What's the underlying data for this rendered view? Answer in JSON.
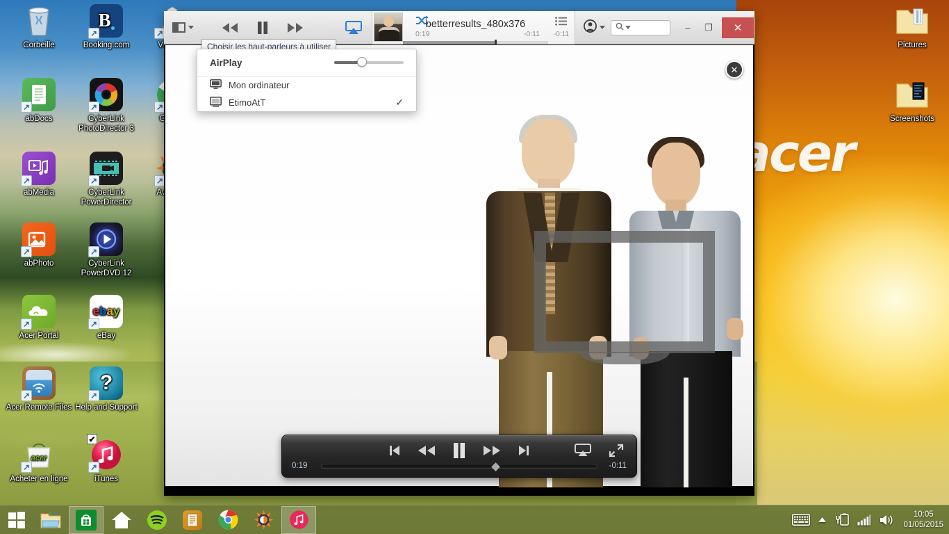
{
  "desktop": {
    "icons": [
      {
        "label": "Corbeille",
        "name": "recycle-bin",
        "kind": "bin",
        "shortcut": false
      },
      {
        "label": "Booking.com",
        "name": "booking-com",
        "kind": "booking",
        "shortcut": true
      },
      {
        "label": "VLC me",
        "name": "vlc-media-player",
        "kind": "vlc",
        "shortcut": true
      },
      {
        "label": "abDocs",
        "name": "abdocs",
        "kind": "abdocs",
        "shortcut": true
      },
      {
        "label": "CyberLink PhotoDirector 3",
        "name": "cyberlink-photodirector",
        "kind": "photodirector",
        "shortcut": true
      },
      {
        "label": "Google",
        "name": "google-chrome",
        "kind": "chrome",
        "shortcut": true
      },
      {
        "label": "abMedia",
        "name": "abmedia",
        "kind": "abmedia",
        "shortcut": true
      },
      {
        "label": "CyberLink PowerDirector",
        "name": "cyberlink-powerdirector",
        "kind": "powerdirector",
        "shortcut": true
      },
      {
        "label": "Avas Ant",
        "name": "avast-antivirus",
        "kind": "avast",
        "shortcut": true
      },
      {
        "label": "abPhoto",
        "name": "abphoto",
        "kind": "abphoto",
        "shortcut": true
      },
      {
        "label": "CyberLink PowerDVD 12",
        "name": "cyberlink-powerdvd",
        "kind": "powerdvd",
        "shortcut": true
      },
      {
        "label": "Acer Portal",
        "name": "acer-portal",
        "kind": "acerportal",
        "shortcut": true
      },
      {
        "label": "eBay",
        "name": "ebay",
        "kind": "ebay",
        "shortcut": true
      },
      {
        "label": "Acer Remote Files",
        "name": "acer-remote-files",
        "kind": "remotefiles",
        "shortcut": true
      },
      {
        "label": "Help and Support",
        "name": "help-and-support",
        "kind": "help",
        "shortcut": true
      },
      {
        "label": "Acheter en ligne",
        "name": "acheter-en-ligne",
        "kind": "acerbag",
        "shortcut": true
      },
      {
        "label": "iTunes",
        "name": "itunes",
        "kind": "itunes",
        "shortcut": true,
        "checked": true
      },
      {
        "label": "Pictures",
        "name": "pictures-folder",
        "kind": "folder",
        "shortcut": false
      },
      {
        "label": "Screenshots",
        "name": "screenshots-folder",
        "kind": "folderdark",
        "shortcut": false
      }
    ],
    "wallpaper_word": "acer"
  },
  "itunes": {
    "toolbar": {
      "view_toggle_icon": "sidebar-toggle-icon",
      "rewind_icon": "rewind-icon",
      "pause_icon": "pause-icon",
      "forward_icon": "fast-forward-icon",
      "airplay_icon": "airplay-icon",
      "tooltip": "Choisir les haut-parleurs à utiliser"
    },
    "lcd": {
      "shuffle_icon": "shuffle-icon",
      "elapsed": "0:19",
      "title": "betterresults_480x376",
      "remaining": "-0:11",
      "list_icon": "list-icon",
      "progress_percent": 63
    },
    "window": {
      "account_icon": "account-icon",
      "account_caret": "chevron-down-icon",
      "search_icon": "search-icon",
      "search_caret": "chevron-down-icon",
      "search_placeholder": "",
      "search_value": "",
      "minimize": "–",
      "maximize": "❐",
      "close": "✕"
    },
    "airplay_popover": {
      "title": "AirPlay",
      "volume_percent": 40,
      "devices": [
        {
          "label": "Mon ordinateur",
          "icon": "computer-icon",
          "selected": false
        },
        {
          "label": "EtimoAtT",
          "icon": "display-icon",
          "selected": true
        }
      ],
      "check_glyph": "✓"
    },
    "video": {
      "close_glyph": "✕",
      "hud": {
        "prev_icon": "skip-previous-icon",
        "rewind_icon": "rewind-icon",
        "pause_icon": "pause-icon",
        "forward_icon": "fast-forward-icon",
        "next_icon": "skip-next-icon",
        "airplay_icon": "airplay-icon",
        "fullscreen_icon": "fullscreen-icon",
        "elapsed": "0:19",
        "remaining": "-0:11",
        "progress_percent": 62
      }
    }
  },
  "taskbar": {
    "start_label": "start-button",
    "items": [
      {
        "name": "file-explorer",
        "kind": "explorer",
        "active": false
      },
      {
        "name": "windows-store",
        "kind": "store",
        "active": true
      },
      {
        "name": "acer-home",
        "kind": "home",
        "active": false
      },
      {
        "name": "spotify",
        "kind": "spotify",
        "active": false
      },
      {
        "name": "notes",
        "kind": "notes",
        "active": false
      },
      {
        "name": "google-chrome",
        "kind": "chrome",
        "active": false
      },
      {
        "name": "avast",
        "kind": "avast",
        "active": false
      },
      {
        "name": "itunes",
        "kind": "itunes",
        "active": true
      }
    ],
    "tray": {
      "keyboard_icon": "keyboard-icon",
      "show_hidden_icon": "chevron-up-icon",
      "battery_icon": "battery-charging-icon",
      "network_icon": "signal-bars-icon",
      "volume_icon": "speaker-icon",
      "time": "10:05",
      "date": "01/05/2015"
    }
  }
}
